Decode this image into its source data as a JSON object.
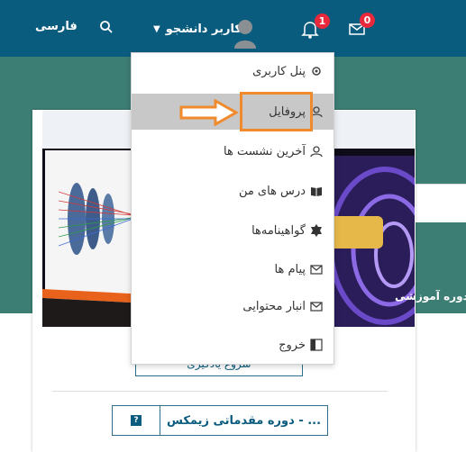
{
  "navbar": {
    "language": "فارسی",
    "user_name": "کاربر دانشجو",
    "notifications_count": "1",
    "messages_count": "0"
  },
  "menu": {
    "items": [
      {
        "label": "پنل کاربری",
        "icon": "gear-icon"
      },
      {
        "label": "پروفایل",
        "icon": "user-icon",
        "active": true
      },
      {
        "label": "آخرین نشست ها",
        "icon": "user-icon"
      },
      {
        "label": "درس های من",
        "icon": "book-icon"
      },
      {
        "label": "گواهینامه‌ها",
        "icon": "certificate-icon"
      },
      {
        "label": "پیام ها",
        "icon": "mail-icon"
      },
      {
        "label": "انبار محتوایی",
        "icon": "mail-icon"
      },
      {
        "label": "خروج",
        "icon": "logout-icon"
      }
    ]
  },
  "course": {
    "title": "دوره آموزشی",
    "start_button": "شروع یادگیری",
    "related_course": "دوره مقدماتی زیمکس - ...",
    "help_label": "?"
  },
  "colors": {
    "navbar": "#0a5c7e",
    "teal_background": "#3d7e74",
    "highlight": "#f08a2c",
    "badge": "#e8283b"
  }
}
